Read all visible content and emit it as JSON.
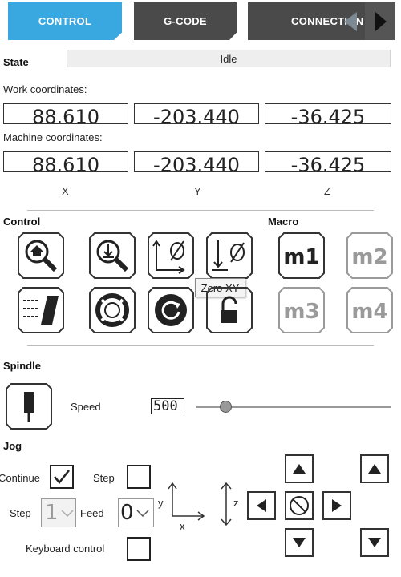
{
  "tabs": [
    {
      "label": "CONTROL",
      "active": true
    },
    {
      "label": "G-CODE",
      "active": false
    },
    {
      "label": "CONNECTION",
      "active": false
    }
  ],
  "state": {
    "label": "State",
    "value": "Idle"
  },
  "work_coordinates": {
    "label": "Work coordinates:",
    "x": "88.610",
    "y": "-203.440",
    "z": "-36.425"
  },
  "machine_coordinates": {
    "label": "Machine coordinates:",
    "x": "88.610",
    "y": "-203.440",
    "z": "-36.425"
  },
  "axes": {
    "x": "X",
    "y": "Y",
    "z": "Z"
  },
  "control": {
    "label": "Control",
    "tooltip": "Zero XY",
    "icons": [
      "home-search-icon",
      "probe-icon",
      "zero-xy-icon",
      "zero-z-icon",
      "run-gcode-icon",
      "help-lifebuoy-icon",
      "reset-icon",
      "unlock-icon"
    ]
  },
  "macro": {
    "label": "Macro",
    "buttons": [
      "m1",
      "m2",
      "m3",
      "m4"
    ]
  },
  "spindle": {
    "label": "Spindle",
    "speed_label": "Speed",
    "speed_value": "500"
  },
  "jog": {
    "label": "Jog",
    "continue_label": "Continue",
    "continue_checked": true,
    "step_label": "Step",
    "step_checked": false,
    "step_select_label": "Step",
    "step_value": "1",
    "feed_label": "Feed",
    "feed_value": "0",
    "keyboard_label": "Keyboard control",
    "keyboard_checked": false,
    "diagram": {
      "y": "y",
      "x": "x",
      "z": "z"
    }
  },
  "colors": {
    "accent": "#3aa8e0",
    "tab_dark": "#4a4a4a",
    "disabled": "#9a9a9a"
  }
}
